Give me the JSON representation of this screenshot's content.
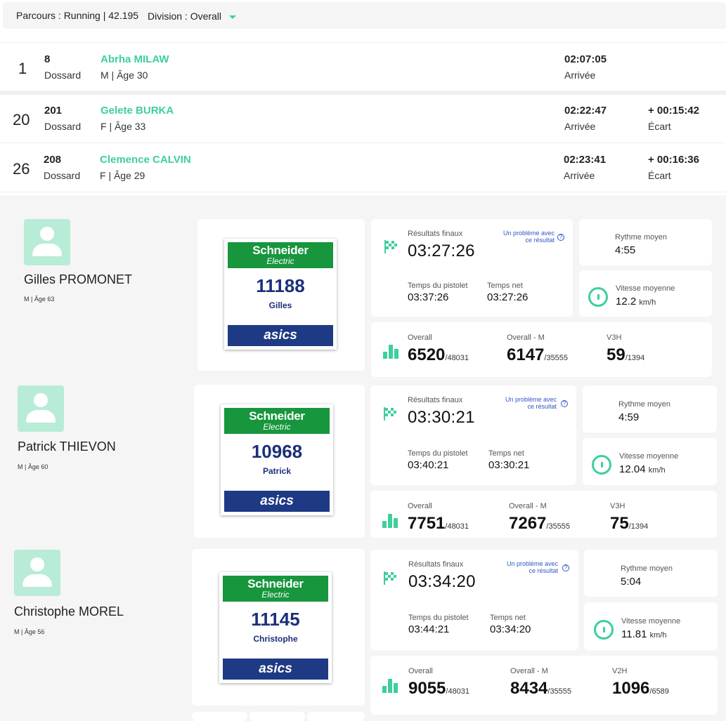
{
  "filter": {
    "parcours": "Parcours : Running | 42.195",
    "division_label": "Division :",
    "division_value": "Overall"
  },
  "labels": {
    "dossard": "Dossard",
    "arrivee": "Arrivée",
    "ecart": "Écart",
    "resultats_finaux": "Résultats finaux",
    "probleme": "Un problème avec ce résultat",
    "temps_pistolet": "Temps du pistolet",
    "temps_net": "Temps net",
    "rythme": "Rythme moyen",
    "vitesse": "Vitesse moyenne",
    "kmh": "km/h",
    "overall": "Overall",
    "overall_m": "Overall - M"
  },
  "leaderboard": [
    {
      "rank": "1",
      "bib": "8",
      "name": "Abrha MILAW",
      "meta": "M | Âge 30",
      "time": "02:07:05",
      "gap": ""
    },
    {
      "rank": "20",
      "bib": "201",
      "name": "Gelete BURKA",
      "meta": "F | Âge 33",
      "time": "02:22:47",
      "gap": "+ 00:15:42"
    },
    {
      "rank": "26",
      "bib": "208",
      "name": "Clemence CALVIN",
      "meta": "F | Âge 29",
      "time": "02:23:41",
      "gap": "+ 00:16:36"
    }
  ],
  "runners": [
    {
      "name": "Gilles PROMONET",
      "meta": "M | Âge 63",
      "bib_sponsor_top": "Schneider",
      "bib_sponsor_sub": "Electric",
      "bib_number": "11188",
      "bib_first_name": "Gilles",
      "bib_sponsor_bottom": "asics",
      "final_time": "03:27:26",
      "gun_time": "03:37:26",
      "net_time": "03:27:26",
      "pace": "4:55",
      "speed": "12.2",
      "overall_rank": "6520",
      "overall_total": "/48031",
      "gender_rank": "6147",
      "gender_total": "/35555",
      "cat_label": "V3H",
      "cat_rank": "59",
      "cat_total": "/1394"
    },
    {
      "name": "Patrick THIEVON",
      "meta": "M | Âge 60",
      "bib_sponsor_top": "Schneider",
      "bib_sponsor_sub": "Electric",
      "bib_number": "10968",
      "bib_first_name": "Patrick",
      "bib_sponsor_bottom": "asics",
      "final_time": "03:30:21",
      "gun_time": "03:40:21",
      "net_time": "03:30:21",
      "pace": "4:59",
      "speed": "12.04",
      "overall_rank": "7751",
      "overall_total": "/48031",
      "gender_rank": "7267",
      "gender_total": "/35555",
      "cat_label": "V3H",
      "cat_rank": "75",
      "cat_total": "/1394"
    },
    {
      "name": "Christophe MOREL",
      "meta": "M | Âge 56",
      "bib_sponsor_top": "Schneider",
      "bib_sponsor_sub": "Electric",
      "bib_number": "11145",
      "bib_first_name": "Christophe",
      "bib_sponsor_bottom": "asics",
      "final_time": "03:34:20",
      "gun_time": "03:44:21",
      "net_time": "03:34:20",
      "pace": "5:04",
      "speed": "11.81",
      "overall_rank": "9055",
      "overall_total": "/48031",
      "gender_rank": "8434",
      "gender_total": "/35555",
      "cat_label": "V2H",
      "cat_rank": "1096",
      "cat_total": "/6589"
    }
  ],
  "colors": {
    "accent": "#3ecf9a",
    "link": "#2f58c9",
    "bib_green": "#17963e",
    "bib_blue": "#1e3a85"
  }
}
